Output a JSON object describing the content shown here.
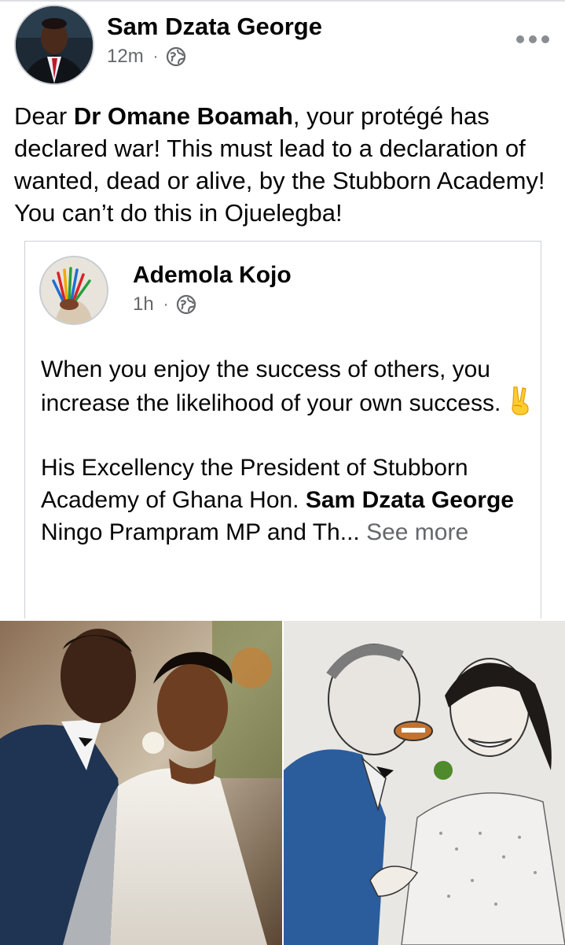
{
  "post": {
    "author": "Sam Dzata George",
    "time": "12m",
    "dot": "·",
    "more_icon": "more-horizontal-icon",
    "audience_icon": "globe-icon",
    "text_before": "Dear ",
    "text_bold": "Dr Omane Boamah",
    "text_after": ", your protégé has declared war! This must lead to a declaration of wanted, dead or alive, by the Stubborn Academy! You can’t do this in Ojuelegba!"
  },
  "shared_post": {
    "author": "Ademola Kojo",
    "time": "1h",
    "dot": "·",
    "audience_icon": "globe-icon",
    "paragraph1": "When you enjoy the success of others, you increase the likelihood of your own success.",
    "emoji_icon": "victory-hand-icon",
    "paragraph2_before": "His Excellency the President of Stubborn Academy of Ghana Hon. ",
    "paragraph2_bold": "Sam Dzata George",
    "paragraph2_line3": "Ningo Prampram MP and Th...",
    "see_more": "See more"
  },
  "photos": [
    {
      "name": "wedding-photo",
      "icon": "photo"
    },
    {
      "name": "wedding-cartoon-drawing",
      "icon": "drawing"
    }
  ],
  "colors": {
    "text": "#050505",
    "secondary": "#65676b",
    "border": "#ced0d4"
  }
}
